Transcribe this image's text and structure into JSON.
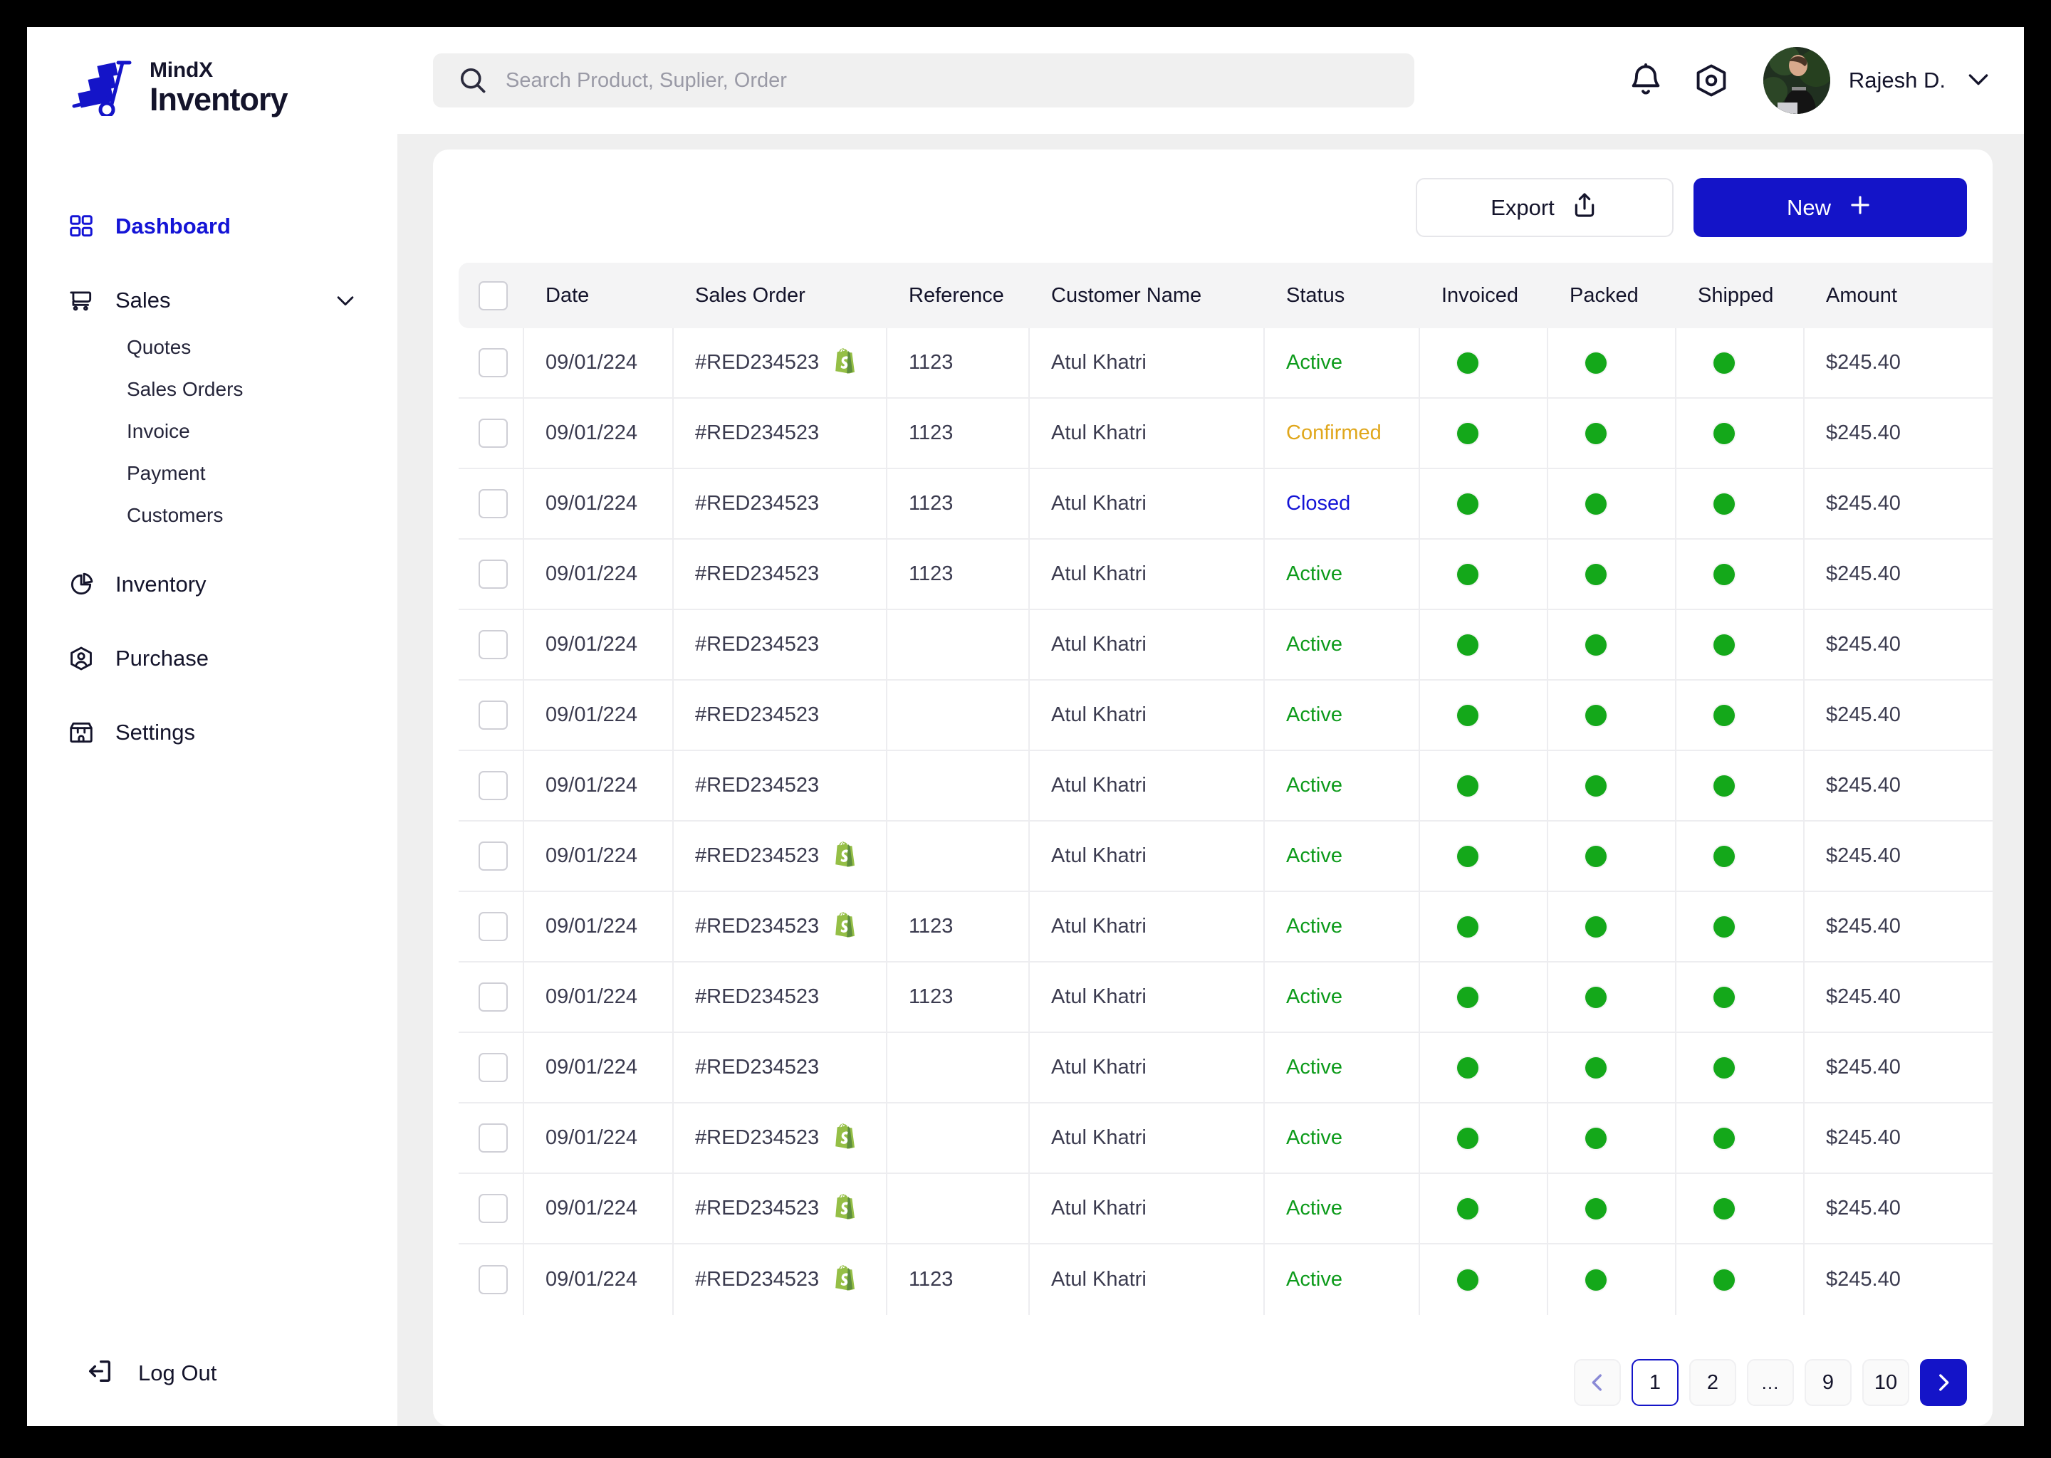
{
  "brand": {
    "line1": "MindX",
    "line2": "Inventory",
    "icon": "hand-truck-logo",
    "color": "#1414c8"
  },
  "sidebar": {
    "items": [
      {
        "label": "Dashboard",
        "icon": "grid-icon",
        "active": true
      },
      {
        "label": "Sales",
        "icon": "cart-icon",
        "expandable": true
      },
      {
        "label": "Inventory",
        "icon": "pie-chart-icon"
      },
      {
        "label": "Purchase",
        "icon": "user-hex-icon"
      },
      {
        "label": "Settings",
        "icon": "store-icon"
      }
    ],
    "sub_items": [
      {
        "label": "Quotes"
      },
      {
        "label": "Sales Orders"
      },
      {
        "label": "Invoice"
      },
      {
        "label": "Payment"
      },
      {
        "label": "Customers"
      }
    ],
    "logout": {
      "label": "Log Out",
      "icon": "logout-icon"
    }
  },
  "topbar": {
    "search": {
      "placeholder": "Search Product, Suplier, Order",
      "value": "",
      "icon": "search-icon"
    },
    "notification_icon": "bell-icon",
    "settings_icon": "gear-hex-icon",
    "user": {
      "name": "Rajesh D.",
      "avatar": "user-photo",
      "chevron": "chevron-down-icon"
    }
  },
  "toolbar": {
    "export_label": "Export",
    "export_icon": "upload-icon",
    "new_label": "New",
    "new_icon": "plus-icon",
    "new_color": "#1414c8"
  },
  "table": {
    "columns": [
      "Date",
      "Sales Order",
      "Reference",
      "Customer Name",
      "Status",
      "Invoiced",
      "Packed",
      "Shipped",
      "Amount"
    ],
    "status_colors": {
      "Active": "#0d9b1b",
      "Confirmed": "#e0a71c",
      "Closed": "#1414d6"
    },
    "dot_color": "#14a81a",
    "rows": [
      {
        "date": "09/01/224",
        "sales_order": "#RED234523",
        "shopify": true,
        "reference": "1123",
        "customer": "Atul Khatri",
        "status": "Active",
        "invoiced": true,
        "packed": true,
        "shipped": true,
        "amount": "$245.40"
      },
      {
        "date": "09/01/224",
        "sales_order": "#RED234523",
        "shopify": false,
        "reference": "1123",
        "customer": "Atul Khatri",
        "status": "Confirmed",
        "invoiced": true,
        "packed": true,
        "shipped": true,
        "amount": "$245.40"
      },
      {
        "date": "09/01/224",
        "sales_order": "#RED234523",
        "shopify": false,
        "reference": "1123",
        "customer": "Atul Khatri",
        "status": "Closed",
        "invoiced": true,
        "packed": true,
        "shipped": true,
        "amount": "$245.40"
      },
      {
        "date": "09/01/224",
        "sales_order": "#RED234523",
        "shopify": false,
        "reference": "1123",
        "customer": "Atul Khatri",
        "status": "Active",
        "invoiced": true,
        "packed": true,
        "shipped": true,
        "amount": "$245.40"
      },
      {
        "date": "09/01/224",
        "sales_order": "#RED234523",
        "shopify": false,
        "reference": "",
        "customer": "Atul Khatri",
        "status": "Active",
        "invoiced": true,
        "packed": true,
        "shipped": true,
        "amount": "$245.40"
      },
      {
        "date": "09/01/224",
        "sales_order": "#RED234523",
        "shopify": false,
        "reference": "",
        "customer": "Atul Khatri",
        "status": "Active",
        "invoiced": true,
        "packed": true,
        "shipped": true,
        "amount": "$245.40"
      },
      {
        "date": "09/01/224",
        "sales_order": "#RED234523",
        "shopify": false,
        "reference": "",
        "customer": "Atul Khatri",
        "status": "Active",
        "invoiced": true,
        "packed": true,
        "shipped": true,
        "amount": "$245.40"
      },
      {
        "date": "09/01/224",
        "sales_order": "#RED234523",
        "shopify": true,
        "reference": "",
        "customer": "Atul Khatri",
        "status": "Active",
        "invoiced": true,
        "packed": true,
        "shipped": true,
        "amount": "$245.40"
      },
      {
        "date": "09/01/224",
        "sales_order": "#RED234523",
        "shopify": true,
        "reference": "1123",
        "customer": "Atul Khatri",
        "status": "Active",
        "invoiced": true,
        "packed": true,
        "shipped": true,
        "amount": "$245.40"
      },
      {
        "date": "09/01/224",
        "sales_order": "#RED234523",
        "shopify": false,
        "reference": "1123",
        "customer": "Atul Khatri",
        "status": "Active",
        "invoiced": true,
        "packed": true,
        "shipped": true,
        "amount": "$245.40"
      },
      {
        "date": "09/01/224",
        "sales_order": "#RED234523",
        "shopify": false,
        "reference": "",
        "customer": "Atul Khatri",
        "status": "Active",
        "invoiced": true,
        "packed": true,
        "shipped": true,
        "amount": "$245.40"
      },
      {
        "date": "09/01/224",
        "sales_order": "#RED234523",
        "shopify": true,
        "reference": "",
        "customer": "Atul Khatri",
        "status": "Active",
        "invoiced": true,
        "packed": true,
        "shipped": true,
        "amount": "$245.40"
      },
      {
        "date": "09/01/224",
        "sales_order": "#RED234523",
        "shopify": true,
        "reference": "",
        "customer": "Atul Khatri",
        "status": "Active",
        "invoiced": true,
        "packed": true,
        "shipped": true,
        "amount": "$245.40"
      },
      {
        "date": "09/01/224",
        "sales_order": "#RED234523",
        "shopify": true,
        "reference": "1123",
        "customer": "Atul Khatri",
        "status": "Active",
        "invoiced": true,
        "packed": true,
        "shipped": true,
        "amount": "$245.40"
      }
    ]
  },
  "pagination": {
    "prev_icon": "chevron-left-icon",
    "next_icon": "chevron-right-icon",
    "pages": [
      "1",
      "2",
      "...",
      "9",
      "10"
    ],
    "current": "1"
  }
}
